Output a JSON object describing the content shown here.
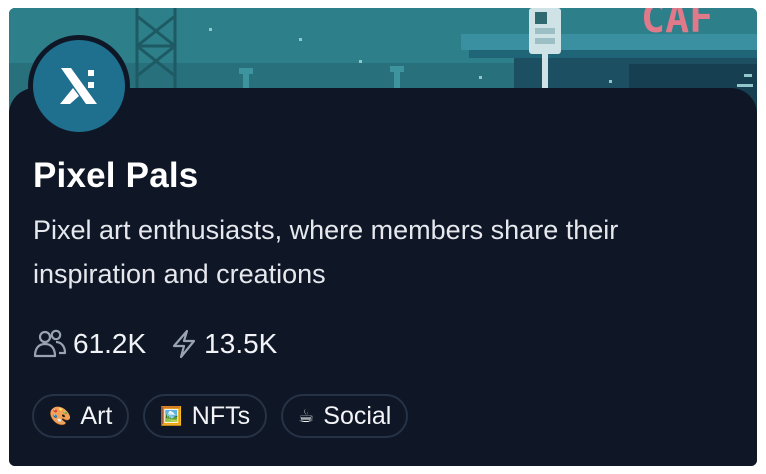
{
  "community": {
    "name": "Pixel Pals",
    "description": "Pixel art enthusiasts, where members share their inspiration and creations",
    "avatar_icon": "lambda-logo-icon",
    "banner_image": "pixel-art-city-scene",
    "banner_sign_text": "CAF"
  },
  "stats": {
    "members": "61.2K",
    "members_icon": "users-icon",
    "activity": "13.5K",
    "activity_icon": "lightning-icon"
  },
  "tags": [
    {
      "emoji": "🎨",
      "label": "Art"
    },
    {
      "emoji": "🖼️",
      "label": "NFTs"
    },
    {
      "emoji": "☕",
      "label": "Social"
    }
  ],
  "colors": {
    "card_background": "#0f1726",
    "avatar_background": "#1f6f8f",
    "banner_teal": "#2a7b86",
    "tag_border": "#263246"
  }
}
